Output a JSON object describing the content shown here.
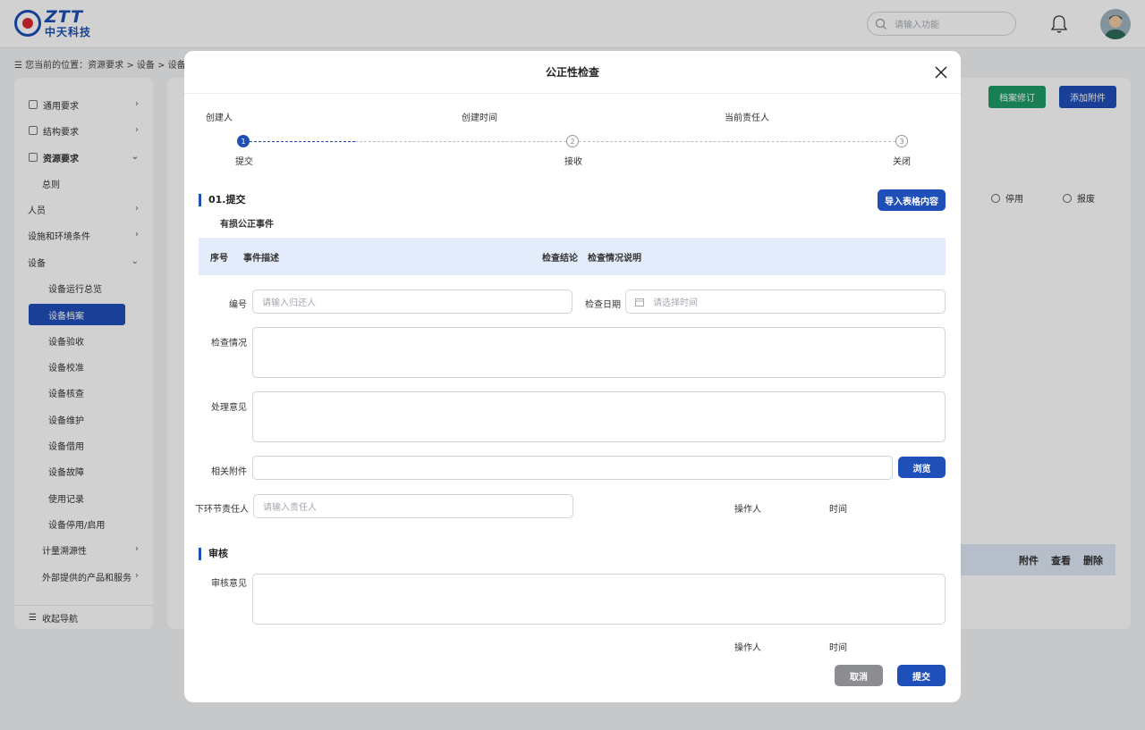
{
  "header": {
    "logo_en": "ZTT",
    "logo_cn": "中天科技",
    "search_placeholder": "请输入功能"
  },
  "breadcrumb": "☰ 您当前的位置：资源要求 > 设备 > 设备档案",
  "sidebar": {
    "items": [
      {
        "label": "通用要求"
      },
      {
        "label": "结构要求"
      },
      {
        "label": "资源要求"
      },
      {
        "label": "总则"
      },
      {
        "label": "人员"
      },
      {
        "label": "设施和环境条件"
      },
      {
        "label": "设备"
      },
      {
        "label": "设备运行总览"
      },
      {
        "label": "设备档案"
      },
      {
        "label": "设备验收"
      },
      {
        "label": "设备校准"
      },
      {
        "label": "设备核查"
      },
      {
        "label": "设备维护"
      },
      {
        "label": "设备借用"
      },
      {
        "label": "设备故障"
      },
      {
        "label": "使用记录"
      },
      {
        "label": "设备停用/启用"
      },
      {
        "label": "计量溯源性"
      },
      {
        "label": "外部提供的产品和服务"
      }
    ],
    "collapse_label": "收起导航"
  },
  "background": {
    "btn_revise": "档案修订",
    "btn_add_attachment": "添加附件",
    "radio_disable": "停用",
    "radio_scrap": "报废",
    "table_actions": [
      "附件",
      "查看",
      "删除"
    ]
  },
  "modal": {
    "title": "公正性检查",
    "meta": {
      "creator": "创建人",
      "created_time": "创建时间",
      "current_owner": "当前责任人"
    },
    "steps": [
      {
        "num": "1",
        "label": "提交"
      },
      {
        "num": "2",
        "label": "接收"
      },
      {
        "num": "3",
        "label": "关闭"
      }
    ],
    "section_submit": "01.提交",
    "import_button": "导入表格内容",
    "sub_title": "有损公正事件",
    "table_headers": [
      "序号",
      "事件描述",
      "检查结论",
      "检查情况说明"
    ],
    "form": {
      "code_label": "编号",
      "code_placeholder": "请输入归还人",
      "date_label": "检查日期",
      "date_placeholder": "请选择时间",
      "situation_label": "检查情况",
      "opinion_label": "处理意见",
      "attachment_label": "相关附件",
      "browse_button": "浏览",
      "next_owner_label": "下环节责任人",
      "next_owner_placeholder": "请输入责任人",
      "operator_label": "操作人",
      "time_label": "时间"
    },
    "section_review": "审核",
    "review": {
      "opinion_label": "审核意见",
      "operator_label": "操作人",
      "time_label": "时间"
    },
    "cancel_button": "取消",
    "submit_button": "提交"
  }
}
